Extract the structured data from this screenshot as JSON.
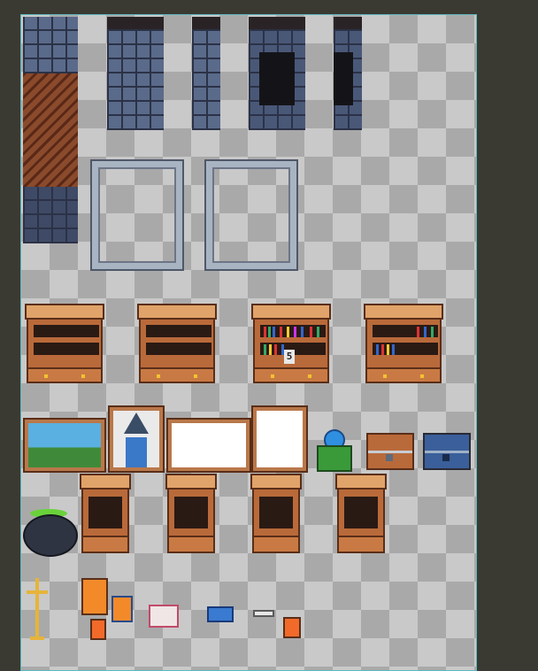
{
  "canvas": {
    "border_color": "#5fb8c0",
    "checker_light": "#c9c9c9",
    "checker_dark": "#a9a9a9",
    "background": "#3a3a32"
  },
  "sprites": [
    "stone-wall-tile",
    "wood-floor-tile",
    "stone-wall-column",
    "stone-wall-column-dark",
    "stone-door-frame",
    "bookshelf-empty",
    "bookshelf-books",
    "landscape-painting",
    "wizard-portrait",
    "blank-frame",
    "crystal-ball",
    "wooden-chest",
    "blue-chest",
    "cauldron",
    "potion-cabinet",
    "candelabra",
    "book-stack",
    "open-book",
    "closed-book",
    "scroll"
  ],
  "shelf_label": "5"
}
